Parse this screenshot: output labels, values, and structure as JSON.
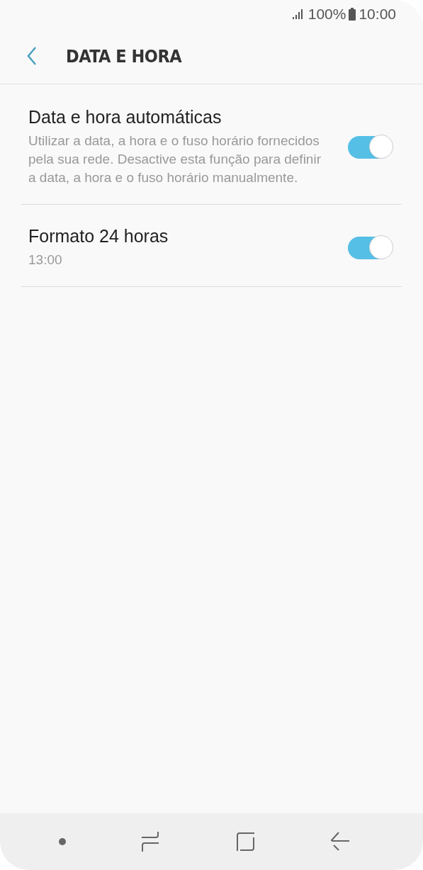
{
  "status_bar": {
    "battery": "100%",
    "time": "10:00"
  },
  "header": {
    "title": "DATA E HORA"
  },
  "settings": [
    {
      "title": "Data e hora automáticas",
      "subtitle": "Utilizar a data, a hora e o fuso horário fornecidos pela sua rede. Desactive esta função para definir a data, a hora e o fuso horário manualmente.",
      "on": true
    },
    {
      "title": "Formato 24 horas",
      "subtitle": "13:00",
      "on": true
    }
  ]
}
